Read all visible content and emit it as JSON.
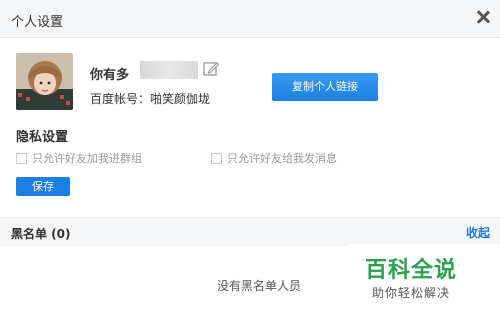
{
  "dialog": {
    "title": "个人设置"
  },
  "profile": {
    "nickname": "你有多",
    "account_line": "百度帐号：啪笑颜伽垅",
    "copy_button": "复制个人链接"
  },
  "privacy": {
    "title": "隐私设置",
    "options": [
      {
        "label": "只允许好友加我进群组",
        "checked": false
      },
      {
        "label": "只允许好友给我发消息",
        "checked": false
      }
    ],
    "save_button": "保存"
  },
  "blacklist": {
    "title": "黑名单 (0)",
    "collapse_link": "收起",
    "empty_text": "没有黑名单人员"
  },
  "watermark": {
    "title": "百科全说",
    "subtitle": "助你轻松解决"
  },
  "colors": {
    "accent": "#1a7fe0",
    "link": "#1e78d8",
    "watermark": "#2ca04f"
  }
}
